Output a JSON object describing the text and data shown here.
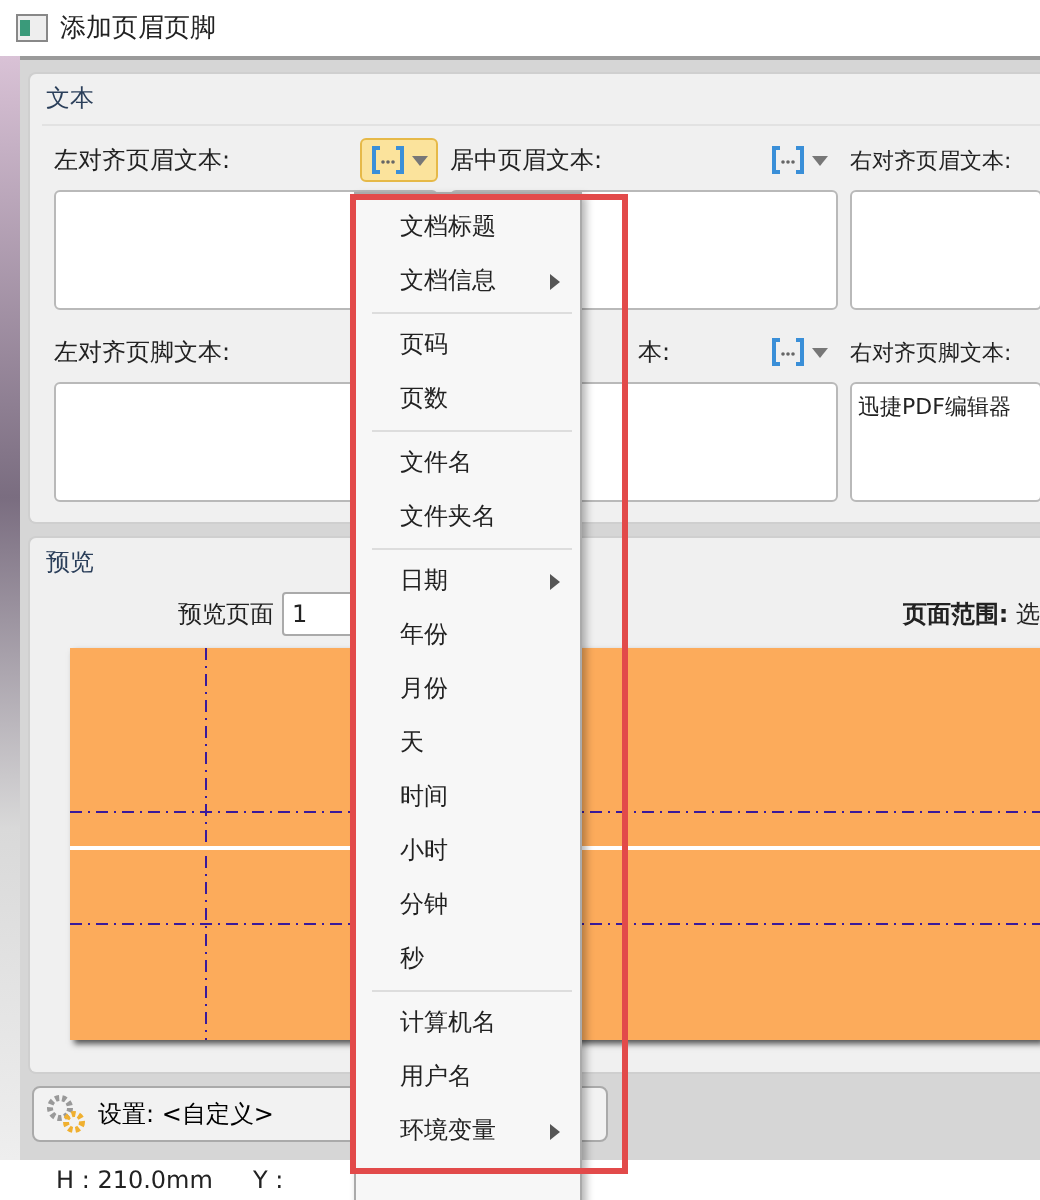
{
  "window": {
    "title": "添加页眉页脚"
  },
  "text_group": {
    "title": "文本",
    "header_fields": [
      {
        "label": "左对齐页眉文本:",
        "insert_button": {
          "active": true
        }
      },
      {
        "label": "居中页眉文本:",
        "insert_button": {
          "active": false
        }
      },
      {
        "label": "右对齐页眉文本:"
      }
    ],
    "footer_fields": [
      {
        "label": "左对齐页脚文本:"
      },
      {
        "label": "本:",
        "insert_button": {
          "active": false
        }
      },
      {
        "label": "右对齐页脚文本:",
        "value": "迅捷PDF编辑器"
      }
    ]
  },
  "preview_group": {
    "title": "预览",
    "page_label": "预览页面",
    "page_value": "1",
    "range_label": "页面范围:",
    "range_value": "选"
  },
  "settings": {
    "label": "设置:",
    "value": "<自定义>"
  },
  "status_bar": [
    {
      "text": "H : 210.0mm"
    },
    {
      "text": "Y :"
    }
  ],
  "insert_menu": [
    {
      "kind": "item",
      "label": "文档标题",
      "submenu": false
    },
    {
      "kind": "item",
      "label": "文档信息",
      "submenu": true
    },
    {
      "kind": "separator"
    },
    {
      "kind": "item",
      "label": "页码",
      "submenu": false
    },
    {
      "kind": "item",
      "label": "页数",
      "submenu": false
    },
    {
      "kind": "separator"
    },
    {
      "kind": "item",
      "label": "文件名",
      "submenu": false
    },
    {
      "kind": "item",
      "label": "文件夹名",
      "submenu": false
    },
    {
      "kind": "separator"
    },
    {
      "kind": "item",
      "label": "日期",
      "submenu": true
    },
    {
      "kind": "item",
      "label": "年份",
      "submenu": false
    },
    {
      "kind": "item",
      "label": "月份",
      "submenu": false
    },
    {
      "kind": "item",
      "label": "天",
      "submenu": false
    },
    {
      "kind": "item",
      "label": "时间",
      "submenu": false
    },
    {
      "kind": "item",
      "label": "小时",
      "submenu": false
    },
    {
      "kind": "item",
      "label": "分钟",
      "submenu": false
    },
    {
      "kind": "item",
      "label": "秒",
      "submenu": false
    },
    {
      "kind": "separator"
    },
    {
      "kind": "item",
      "label": "计算机名",
      "submenu": false
    },
    {
      "kind": "item",
      "label": "用户名",
      "submenu": false
    },
    {
      "kind": "item",
      "label": "环境变量",
      "submenu": true
    }
  ]
}
